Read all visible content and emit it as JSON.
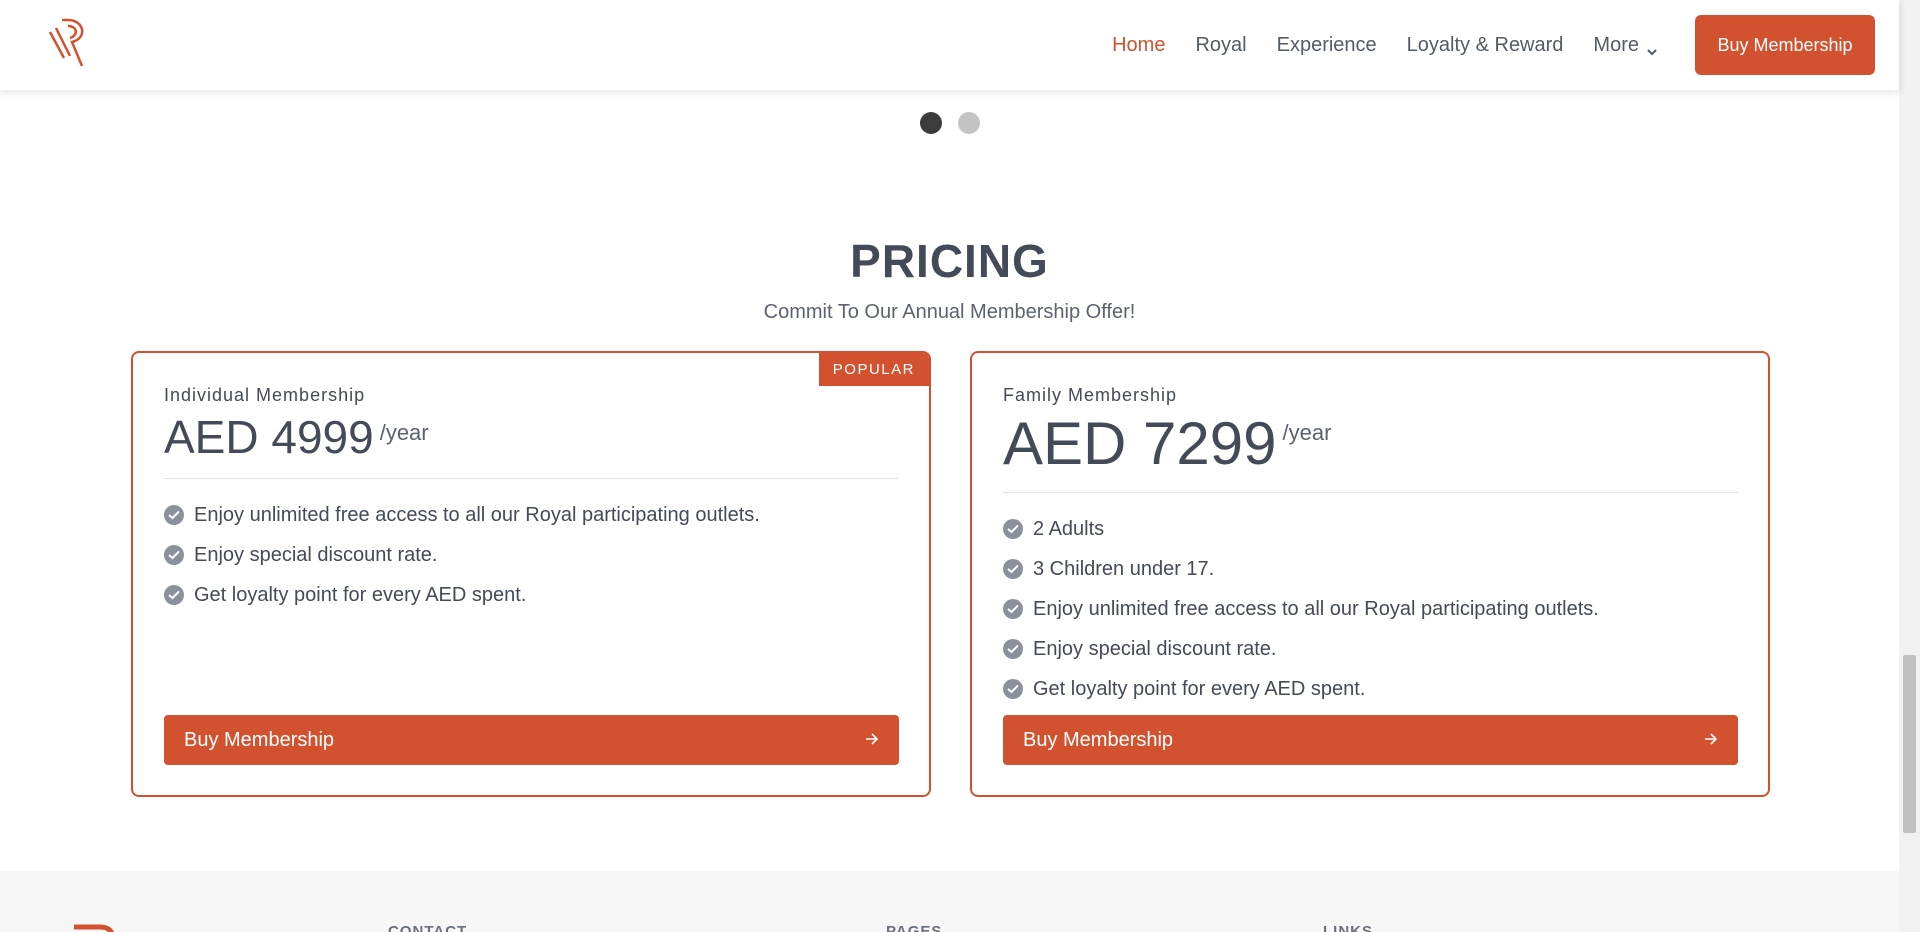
{
  "header": {
    "nav": [
      {
        "label": "Home",
        "active": true
      },
      {
        "label": "Royal"
      },
      {
        "label": "Experience"
      },
      {
        "label": "Loyalty & Reward"
      },
      {
        "label": "More",
        "dropdown": true
      }
    ],
    "cta_label": "Buy Membership"
  },
  "carousel": {
    "dot_count": 2,
    "active_index": 0
  },
  "pricing": {
    "title": "PRICING",
    "subtitle": "Commit To Our Annual Membership Offer!",
    "plans": [
      {
        "name": "Individual Membership",
        "price": "AED 4999",
        "period": "/year",
        "badge": "POPULAR",
        "features": [
          "Enjoy unlimited free access to all our Royal participating outlets.",
          "Enjoy special discount rate.",
          "Get loyalty point for every AED spent."
        ],
        "button_label": "Buy Membership"
      },
      {
        "name": "Family Membership",
        "price": "AED 7299",
        "period": "/year",
        "features": [
          "2 Adults",
          "3 Children under 17.",
          "Enjoy unlimited free access to all our Royal participating outlets.",
          "Enjoy special discount rate.",
          "Get loyalty point for every AED spent."
        ],
        "button_label": "Buy Membership"
      }
    ]
  },
  "footer": {
    "columns": [
      "CONTACT",
      "PAGES",
      "LINKS"
    ]
  },
  "colors": {
    "brand": "#d2522f",
    "text": "#434b58",
    "check": "#8a919d"
  },
  "icons": {
    "feature": "check-circle-icon",
    "button": "arrow-right-icon",
    "nav_more": "chevron-down-icon"
  }
}
